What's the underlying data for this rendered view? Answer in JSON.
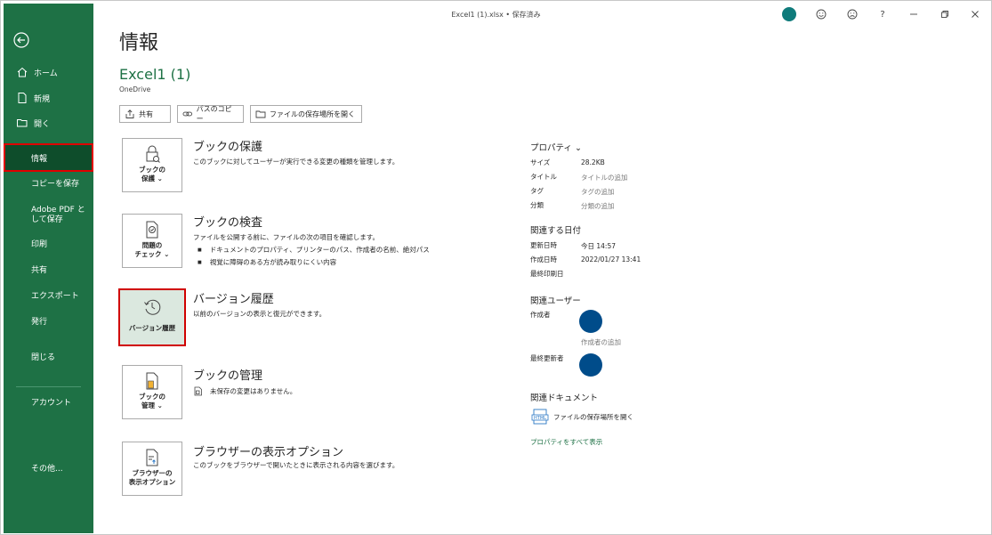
{
  "titlebar": {
    "title": "Excel1 (1).xlsx • 保存済み",
    "help_label": "?"
  },
  "sidebar": {
    "items": [
      {
        "label": "ホーム"
      },
      {
        "label": "新規"
      },
      {
        "label": "開く"
      },
      {
        "label": "情報"
      },
      {
        "label": "コピーを保存"
      },
      {
        "label": "Adobe PDF として保存"
      },
      {
        "label": "印刷"
      },
      {
        "label": "共有"
      },
      {
        "label": "エクスポート"
      },
      {
        "label": "発行"
      },
      {
        "label": "閉じる"
      },
      {
        "label": "アカウント"
      },
      {
        "label": "その他..."
      }
    ]
  },
  "main": {
    "page_title": "情報",
    "doc_name": "Excel1 (1)",
    "doc_location": "OneDrive",
    "actions": {
      "share": "共有",
      "copy_path": "パスのコピー",
      "open_location": "ファイルの保存場所を開く"
    },
    "sections": [
      {
        "button_label": "ブックの\n保護 ⌄",
        "title": "ブックの保護",
        "desc": "このブックに対してユーザーが実行できる変更の種類を管理します。"
      },
      {
        "button_label": "問題の\nチェック ⌄",
        "title": "ブックの検査",
        "desc": "ファイルを公開する前に、ファイルの次の項目を確認します。",
        "bullets": [
          "ドキュメントのプロパティ、プリンターのパス、作成者の名前、絶対パス",
          "視覚に障碍のある方が読み取りにくい内容"
        ]
      },
      {
        "button_label": "バージョン履歴",
        "title": "バージョン履歴",
        "desc": "以前のバージョンの表示と復元ができます。"
      },
      {
        "button_label": "ブックの\n管理 ⌄",
        "title": "ブックの管理",
        "desc": "未保存の変更はありません。"
      },
      {
        "button_label": "ブラウザーの\n表示オプション",
        "title": "ブラウザーの表示オプション",
        "desc": "このブックをブラウザーで開いたときに表示される内容を選びます。"
      }
    ]
  },
  "properties": {
    "header": "プロパティ ⌄",
    "rows": [
      {
        "key": "サイズ",
        "value": "28.2KB"
      },
      {
        "key": "タイトル",
        "value": "タイトルの追加"
      },
      {
        "key": "タグ",
        "value": "タグの追加"
      },
      {
        "key": "分類",
        "value": "分類の追加"
      }
    ],
    "dates_header": "関連する日付",
    "dates": [
      {
        "key": "更新日時",
        "value": "今日 14:57"
      },
      {
        "key": "作成日時",
        "value": "2022/01/27 13:41"
      },
      {
        "key": "最終印刷日",
        "value": ""
      }
    ],
    "people_header": "関連ユーザー",
    "author_label": "作成者",
    "add_author": "作成者の追加",
    "last_modified_by": "最終更新者",
    "docs_header": "関連ドキュメント",
    "open_location_link": "ファイルの保存場所を開く",
    "show_all": "プロパティをすべて表示"
  },
  "colors": {
    "accent": "#1e7145",
    "highlight": "#e00000",
    "avatar": "#004c8a",
    "account_badge": "#0f7b7b"
  }
}
